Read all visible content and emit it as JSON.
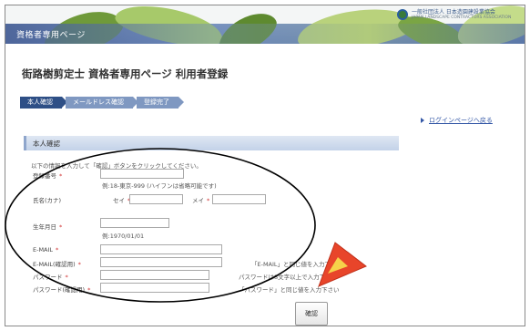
{
  "banner": {
    "label": "資格者専用ページ",
    "org_name": "一般社団法人 日本造園建設業協会",
    "org_sub": "JAPAN LANDSCAPE CONTRACTORS ASSOCIATION"
  },
  "page": {
    "title": "街路樹剪定士 資格者専用ページ 利用者登録"
  },
  "steps": [
    {
      "label": "本人確認",
      "state": "current"
    },
    {
      "label": "メールドレス確認",
      "state": "next"
    },
    {
      "label": "登録完了",
      "state": "next"
    }
  ],
  "login_link": "ログインページへ戻る",
  "section": {
    "title": "本人確認",
    "instruction": "以下の情報を入力して「確認」ボタンをクリックしてください。"
  },
  "form": {
    "reg_number_label": "登録番号",
    "reg_number_hint": "例:18-東京-999 (ハイフンは省略可能です)",
    "name_kana_label": "氏名(カナ)",
    "sei_label": "セイ",
    "mei_label": "メイ",
    "birthdate_label": "生年月日",
    "birthdate_hint": "例:1970/01/01",
    "email_label": "E-MAIL",
    "email_confirm_label": "E-MAIL(確認用)",
    "email_confirm_hint": "「E-MAIL」と同じ値を入力下さい",
    "password_label": "パスワード",
    "password_hint": "パスワードは8文字以上で入力下さい",
    "password_confirm_label": "パスワード(確認用)",
    "password_confirm_hint": "「パスワード」と同じ値を入力下さい",
    "required_mark": "*"
  },
  "confirm_button": "確認",
  "annotation": {
    "ellipse_color": "#000000",
    "arrow_color": "#e8452a"
  }
}
